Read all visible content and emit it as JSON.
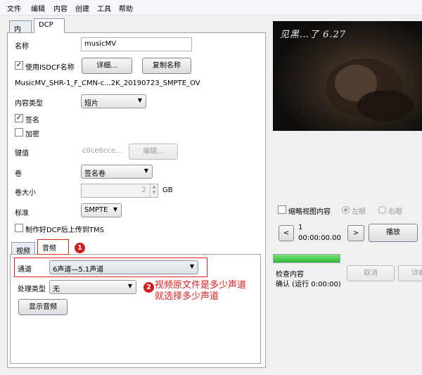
{
  "menu": [
    "文件",
    "编辑",
    "内容",
    "创建",
    "工具",
    "帮助"
  ],
  "main_tabs": [
    "内容",
    "DCP"
  ],
  "dcp": {
    "name_label": "名称",
    "name_value": "musicMV",
    "use_isdcf_label": "使用ISDCF名称",
    "details_button": "详细...",
    "copy_name_button": "复制名称",
    "dcp_full_name": "MusicMV_SHR-1_F_CMN-c...2K_20190723_SMPTE_OV",
    "content_type_label": "内容类型",
    "content_type_value": "短片",
    "signed_label": "签名",
    "encrypted_label": "加密",
    "key_label": "键值",
    "key_value": "c0ce6cce...",
    "edit_button": "编辑...",
    "volume_label": "卷",
    "volume_value": "签名卷",
    "volume_size_label": "卷大小",
    "volume_size_value": "2",
    "volume_size_unit": "GB",
    "standard_label": "标准",
    "standard_value": "SMPTE",
    "upload_tms_label": "制作好DCP后上传到TMS"
  },
  "sub_tabs": [
    "视频",
    "音频"
  ],
  "audio": {
    "channel_label": "通道",
    "channel_value": "6声道—5.1声道",
    "processor_label": "处理类型",
    "processor_value": "无",
    "show_audio_button": "显示音频"
  },
  "annotations": {
    "badge1": "1",
    "badge2": "2",
    "note_line1": "视频原文件是多少声道",
    "note_line2": "就选择多少声道"
  },
  "preview": {
    "poster_text": "见黑…了 6.27",
    "thumbnail_label": "缩略视图内容",
    "left_eye_label": "左眼",
    "right_eye_label": "右眼",
    "prev_button": "<",
    "next_button": ">",
    "frame_number": "1",
    "timecode": "00:00:00.00",
    "play_button": "播放",
    "check_content_label": "检查内容",
    "confirm_status": "确认 (运行 0:00:00)",
    "cancel_button": "取消",
    "details_button": "详细"
  },
  "colors": {
    "annotation_red": "#e0251b",
    "progress_green": "#35c23a"
  },
  "progress": 1.0
}
